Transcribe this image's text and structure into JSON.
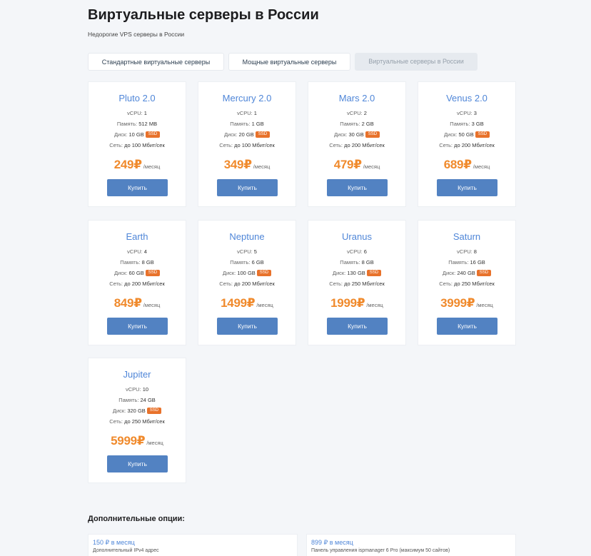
{
  "header": {
    "title": "Виртуальные серверы в России",
    "subtitle": "Недорогие VPS серверы в России"
  },
  "tabs": [
    {
      "label": "Стандартные виртуальные серверы",
      "active": false
    },
    {
      "label": "Мощные виртуальные серверы",
      "active": false
    },
    {
      "label": "Виртуальные серверы в России",
      "active": true
    }
  ],
  "spec_labels": {
    "cpu": "vCPU:",
    "ram": "Память:",
    "disk": "Диск:",
    "net": "Сеть:",
    "ssd_badge": "SSD"
  },
  "plans": [
    {
      "name": "Pluto 2.0",
      "cpu": "1",
      "ram": "512 MB",
      "disk": "10 GB",
      "net": "до 100 Мбит/сек",
      "price": "249₽",
      "period": "/месяц",
      "buy": "Купить"
    },
    {
      "name": "Mercury 2.0",
      "cpu": "1",
      "ram": "1 GB",
      "disk": "20 GB",
      "net": "до 100 Мбит/сек",
      "price": "349₽",
      "period": "/месяц",
      "buy": "Купить"
    },
    {
      "name": "Mars 2.0",
      "cpu": "2",
      "ram": "2 GB",
      "disk": "30 GB",
      "net": "до 200 Мбит/сек",
      "price": "479₽",
      "period": "/месяц",
      "buy": "Купить"
    },
    {
      "name": "Venus 2.0",
      "cpu": "3",
      "ram": "3 GB",
      "disk": "50 GB",
      "net": "до 200 Мбит/сек",
      "price": "689₽",
      "period": "/месяц",
      "buy": "Купить"
    },
    {
      "name": "Earth",
      "cpu": "4",
      "ram": "8 GB",
      "disk": "60 GB",
      "net": "до 200 Мбит/сек",
      "price": "849₽",
      "period": "/месяц",
      "buy": "Купить"
    },
    {
      "name": "Neptune",
      "cpu": "5",
      "ram": "6 GB",
      "disk": "100 GB",
      "net": "до 200 Мбит/сек",
      "price": "1499₽",
      "period": "/месяц",
      "buy": "Купить"
    },
    {
      "name": "Uranus",
      "cpu": "6",
      "ram": "8 GB",
      "disk": "130 GB",
      "net": "до 250 Мбит/сек",
      "price": "1999₽",
      "period": "/месяц",
      "buy": "Купить"
    },
    {
      "name": "Saturn",
      "cpu": "8",
      "ram": "16 GB",
      "disk": "240 GB",
      "net": "до 250 Мбит/сек",
      "price": "3999₽",
      "period": "/месяц",
      "buy": "Купить"
    },
    {
      "name": "Jupiter",
      "cpu": "10",
      "ram": "24 GB",
      "disk": "320 GB",
      "net": "до 250 Мбит/сек",
      "price": "5999₽",
      "period": "/месяц",
      "buy": "Купить"
    }
  ],
  "extras": {
    "title": "Дополнительные опции:",
    "options": [
      {
        "price": "150 ₽ в месяц",
        "desc": "Дополнительный IPv4 адрес"
      },
      {
        "price": "899 ₽ в месяц",
        "desc": "Панель управления ispmanager 6 Pro (максимум 50 сайтов)"
      }
    ]
  },
  "colors": {
    "accent": "#4f86d8",
    "price": "#f08a2c",
    "button": "#5282c2",
    "ssd_badge": "#e8722b",
    "background": "#f4f6f9"
  }
}
